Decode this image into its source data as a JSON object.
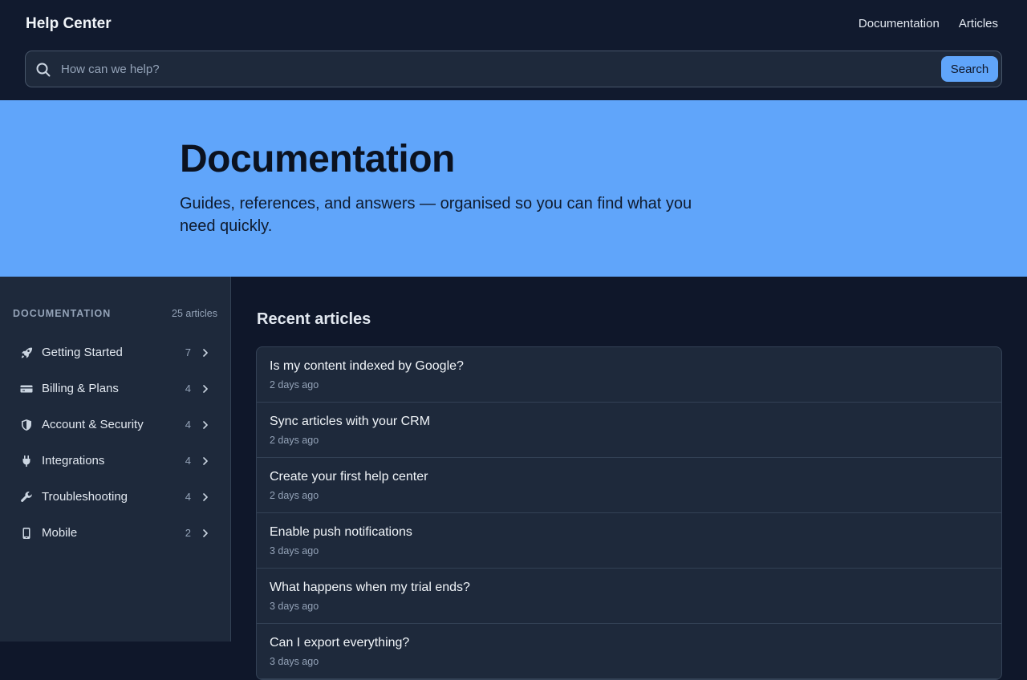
{
  "header": {
    "brand": "Help Center",
    "nav": [
      {
        "label": "Documentation"
      },
      {
        "label": "Articles"
      }
    ],
    "search": {
      "placeholder": "How can we help?",
      "value": "",
      "button_label": "Search"
    }
  },
  "hero": {
    "title": "Documentation",
    "subtitle": "Guides, references, and answers — organised so you can find what you need quickly."
  },
  "sidebar": {
    "title": "DOCUMENTATION",
    "count": "25 articles",
    "items": [
      {
        "label": "Getting Started",
        "count": "7",
        "icon": "rocket-icon"
      },
      {
        "label": "Billing & Plans",
        "count": "4",
        "icon": "credit-card-icon"
      },
      {
        "label": "Account & Security",
        "count": "4",
        "icon": "shield-icon"
      },
      {
        "label": "Integrations",
        "count": "4",
        "icon": "plug-icon"
      },
      {
        "label": "Troubleshooting",
        "count": "4",
        "icon": "wrench-icon"
      },
      {
        "label": "Mobile",
        "count": "2",
        "icon": "mobile-icon"
      }
    ]
  },
  "main": {
    "section_title": "Recent articles",
    "articles": [
      {
        "title": "Is my content indexed by Google?",
        "meta": "2 days ago"
      },
      {
        "title": "Sync articles with your CRM",
        "meta": "2 days ago"
      },
      {
        "title": "Create your first help center",
        "meta": "2 days ago"
      },
      {
        "title": "Enable push notifications",
        "meta": "3 days ago"
      },
      {
        "title": "What happens when my trial ends?",
        "meta": "3 days ago"
      },
      {
        "title": "Can I export everything?",
        "meta": "3 days ago"
      }
    ]
  },
  "colors": {
    "accent": "#60a5fa",
    "background": "#0f172a",
    "panel": "#1e293b"
  }
}
